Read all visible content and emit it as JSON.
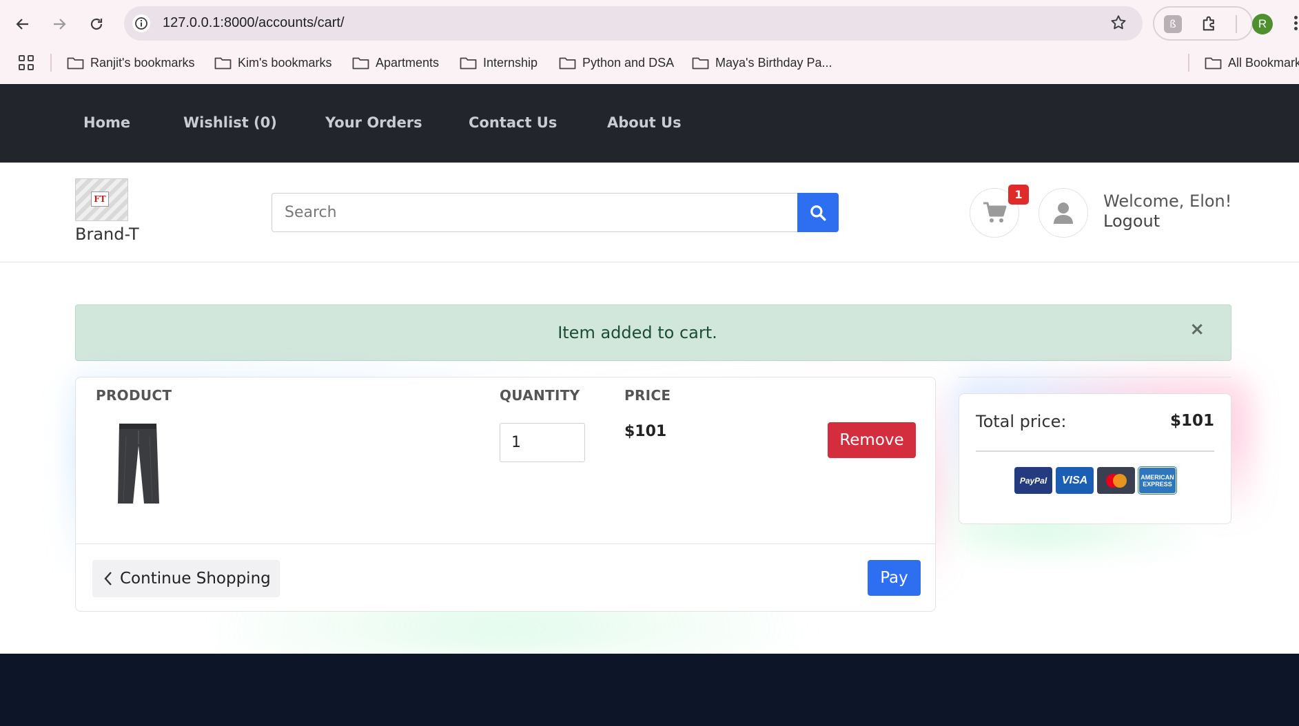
{
  "browser": {
    "url": "127.0.0.1:8000/accounts/cart/",
    "profile_initial": "R",
    "bookmarks": [
      "Ranjit's bookmarks",
      "Kim's bookmarks",
      "Apartments",
      "Internship",
      "Python and DSA",
      "Maya's Birthday Pa...",
      "All Bookmarks"
    ]
  },
  "navbar": {
    "links": [
      "Home",
      "Wishlist (0)",
      "Your Orders",
      "Contact Us",
      "About Us"
    ]
  },
  "header": {
    "brand": "Brand-T",
    "logo_mark": "FT",
    "search_placeholder": "Search",
    "cart_count": "1",
    "welcome": "Welcome, Elon!",
    "logout": "Logout"
  },
  "alert": {
    "message": "Item added to cart.",
    "close": "×"
  },
  "cart": {
    "columns": {
      "product": "PRODUCT",
      "quantity": "QUANTITY",
      "price": "PRICE"
    },
    "items": [
      {
        "quantity": "1",
        "price": "$101",
        "remove_label": "Remove"
      }
    ],
    "continue_label": "Continue Shopping",
    "pay_label": "Pay"
  },
  "summary": {
    "total_label": "Total price:",
    "total_value": "$101",
    "payment_methods": [
      "PayPal",
      "VISA",
      "mastercard",
      "AMERICAN EXPRESS"
    ]
  },
  "colors": {
    "navbar_bg": "#22262c",
    "primary": "#2e6ff2",
    "danger": "#d42d3d",
    "alert_bg": "#d2e7dc",
    "footer_bg": "#0d1628"
  }
}
